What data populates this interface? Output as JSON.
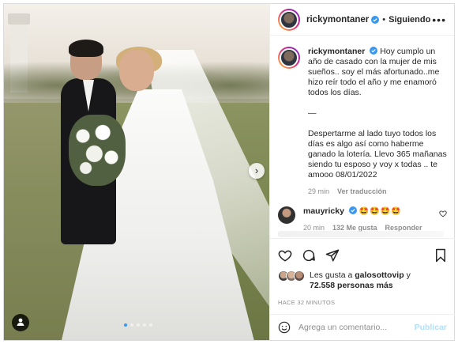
{
  "post": {
    "username": "rickymontaner",
    "follow_label": "Siguiendo",
    "separator": "•",
    "more": "•••",
    "verified": true
  },
  "caption": {
    "username": "rickymontaner",
    "text": "Hoy cumplo un año de casado con la mujer de mis sueños.. soy el más afortunado..me hizo reír todo el año y me enamoró todos los días.\n\n—\n\nDespertarme al lado tuyo todos los días es algo así como haberme ganado la lotería. Llevo 365 mañanas siendo tu esposo y voy x todas .. te amooo 08/01/2022",
    "time": "29 min",
    "translate": "Ver traducción"
  },
  "comment": {
    "username": "mauyricky",
    "text": "🤩🤩🤩🤩",
    "time": "20 min",
    "likes": "132 Me gusta",
    "reply": "Responder"
  },
  "likes": {
    "prefix": "Les gusta a",
    "user": "galosottovip",
    "connector": "y",
    "count": "72.558 personas más"
  },
  "timestamp": "HACE 32 MINUTOS",
  "composer": {
    "placeholder": "Agrega un comentario...",
    "publish": "Publicar"
  },
  "carousel": {
    "next": "›",
    "slides": 5,
    "active_index": 0
  },
  "colors": {
    "accent": "#3897f0",
    "publish_disabled": "#b2dffc",
    "muted": "#8e8e8e",
    "text": "#262626"
  },
  "icons": [
    "heart-icon",
    "comment-icon",
    "share-icon",
    "bookmark-icon",
    "smile-icon",
    "verified-icon",
    "user-tag-icon",
    "chevron-right-icon",
    "more-icon"
  ]
}
